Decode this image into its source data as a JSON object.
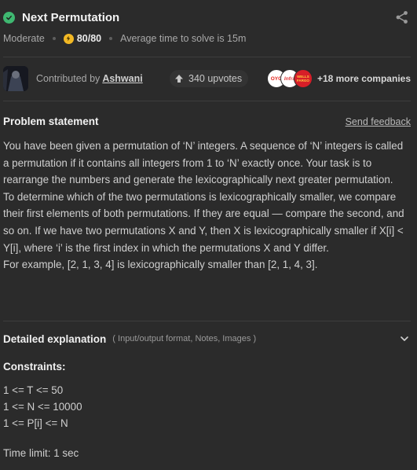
{
  "header": {
    "title": "Next Permutation",
    "difficulty": "Moderate",
    "score": "80/80",
    "avg_time": "Average time to solve is 15m"
  },
  "contributor": {
    "prefix": "Contributed by",
    "name": "Ashwani",
    "upvotes": "340 upvotes",
    "companies": [
      "OYO",
      "Infra",
      "WELLS FARGO"
    ],
    "more_companies": "+18 more companies"
  },
  "problem": {
    "heading": "Problem statement",
    "feedback_link": "Send feedback",
    "paragraphs": [
      "You have been given a permutation of ‘N’ integers. A sequence of ‘N’ integers is called a permutation if it contains all integers from 1 to ‘N’ exactly once. Your task is to rearrange the numbers and generate the lexicographically next greater permutation.",
      "To determine which of the two permutations is lexicographically smaller, we compare their first elements of both permutations. If they are equal — compare the second, and so on. If we have two permutations X and Y, then X is lexicographically smaller if X[i] < Y[i], where ‘i’ is the first index in which the permutations X and Y differ.",
      "For example, [2, 1, 3, 4] is lexicographically smaller than [2, 1, 4, 3]."
    ]
  },
  "details": {
    "title": "Detailed explanation",
    "subtitle": "( Input/output format, Notes, Images )"
  },
  "constraints": {
    "title": "Constraints:",
    "lines": [
      "1 <= T <= 50",
      "1 <= N <= 10000",
      "1 <= P[i] <= N"
    ],
    "time_limit": "Time limit: 1 sec"
  },
  "colors": {
    "background": "#2b2b2b",
    "success": "#3fb871",
    "score_badge": "#f2b824"
  }
}
